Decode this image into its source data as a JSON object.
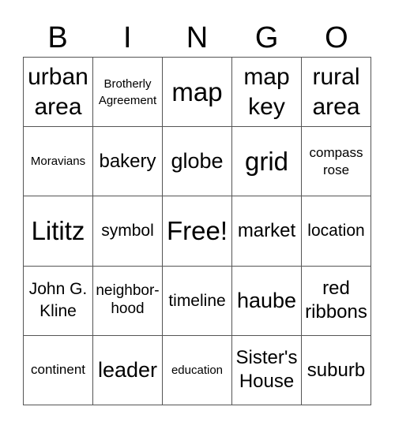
{
  "header": {
    "letters": [
      "B",
      "I",
      "N",
      "G",
      "O"
    ]
  },
  "board": {
    "rows": [
      [
        "urban area",
        "Brotherly Agreement",
        "map",
        "map key",
        "rural area"
      ],
      [
        "Moravians",
        "bakery",
        "globe",
        "grid",
        "compass rose"
      ],
      [
        "Lititz",
        "symbol",
        "Free!",
        "market",
        "location"
      ],
      [
        "John G. Kline",
        "neighbor-hood",
        "timeline",
        "haube",
        "red ribbons"
      ],
      [
        "continent",
        "leader",
        "education",
        "Sister's House",
        "suburb"
      ]
    ],
    "free_space": "Free!"
  },
  "colors": {
    "border": "#555555",
    "text": "#000000",
    "background": "#ffffff"
  }
}
